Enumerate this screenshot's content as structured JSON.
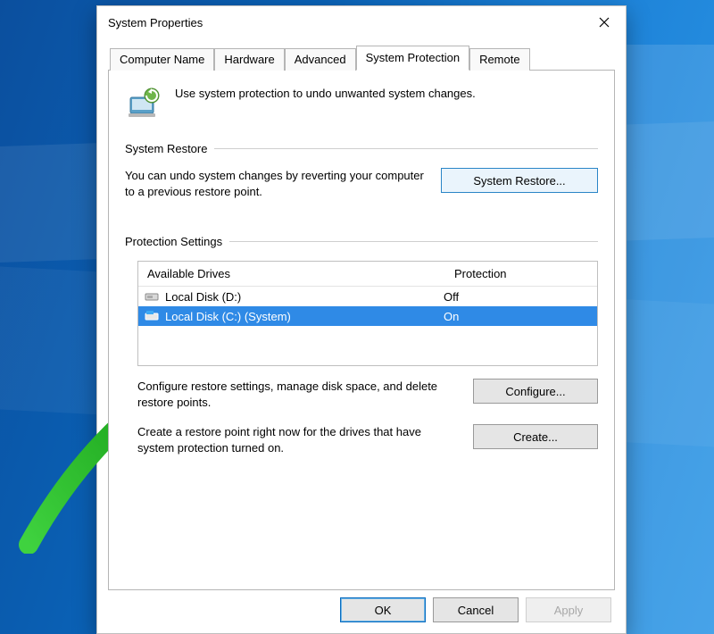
{
  "window": {
    "title": "System Properties"
  },
  "tabs": [
    "Computer Name",
    "Hardware",
    "Advanced",
    "System Protection",
    "Remote"
  ],
  "active_tab": 3,
  "intro_text": "Use system protection to undo unwanted system changes.",
  "groups": {
    "restore": {
      "header": "System Restore",
      "desc": "You can undo system changes by reverting your computer to a previous restore point.",
      "button": "System Restore..."
    },
    "protection": {
      "header": "Protection Settings",
      "columns": {
        "name": "Available Drives",
        "protection": "Protection"
      },
      "drives": [
        {
          "icon": "drive-icon",
          "name": "Local Disk (D:)",
          "protection": "Off",
          "selected": false
        },
        {
          "icon": "system-drive-icon",
          "name": "Local Disk (C:) (System)",
          "protection": "On",
          "selected": true
        }
      ],
      "configure_desc": "Configure restore settings, manage disk space, and delete restore points.",
      "configure_button": "Configure...",
      "create_desc": "Create a restore point right now for the drives that have system protection turned on.",
      "create_button": "Create..."
    }
  },
  "buttons": {
    "ok": "OK",
    "cancel": "Cancel",
    "apply": "Apply"
  },
  "annotations": {
    "arrow1_target": "system-restore-button",
    "arrow2_target": "drive-row-selected"
  }
}
